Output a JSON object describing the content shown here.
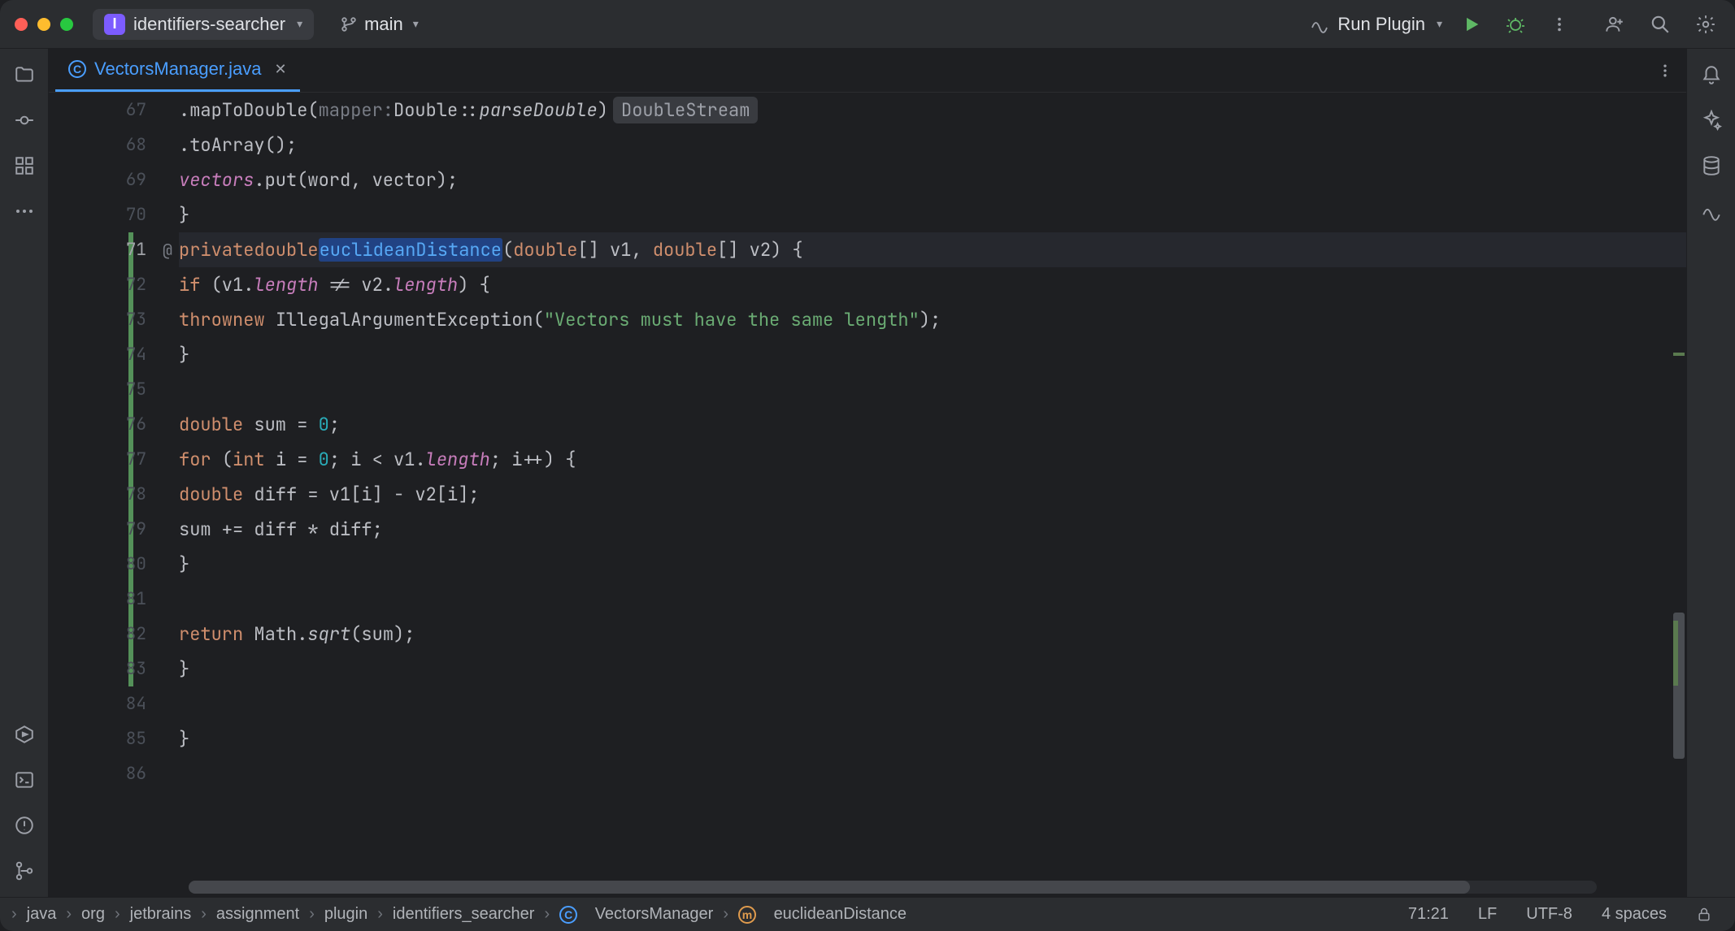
{
  "project": {
    "icon_letter": "I",
    "name": "identifiers-searcher"
  },
  "branch": "main",
  "run_config": "Run Plugin",
  "tab": {
    "filename": "VectorsManager.java"
  },
  "code": {
    "lines": [
      {
        "n": 67,
        "kind": "plain"
      },
      {
        "n": 68,
        "kind": "plain"
      },
      {
        "n": 69,
        "kind": "plain"
      },
      {
        "n": 70,
        "kind": "plain"
      },
      {
        "n": 71,
        "kind": "active"
      },
      {
        "n": 72,
        "kind": "plain"
      },
      {
        "n": 73,
        "kind": "plain"
      },
      {
        "n": 74,
        "kind": "plain"
      },
      {
        "n": 75,
        "kind": "plain"
      },
      {
        "n": 76,
        "kind": "plain"
      },
      {
        "n": 77,
        "kind": "plain"
      },
      {
        "n": 78,
        "kind": "plain"
      },
      {
        "n": 79,
        "kind": "plain"
      },
      {
        "n": 80,
        "kind": "plain"
      },
      {
        "n": 81,
        "kind": "plain"
      },
      {
        "n": 82,
        "kind": "plain"
      },
      {
        "n": 83,
        "kind": "plain"
      },
      {
        "n": 84,
        "kind": "plain"
      },
      {
        "n": 85,
        "kind": "plain"
      },
      {
        "n": 86,
        "kind": "plain"
      }
    ],
    "l67_method": ".mapToDouble(",
    "l67_hint_label": "mapper:",
    "l67_ref": "Double::",
    "l67_fn": "parseDouble",
    "l67_close": ")",
    "l67_inlay": "DoubleStream",
    "l68": ".toArray();",
    "l69_a": "vectors",
    "l69_b": ".put(word, vector);",
    "l70": "}",
    "l71_kw1": "private",
    "l71_kw2": "double",
    "l71_fn": "euclideanDistance",
    "l71_sig": "(",
    "l71_t1": "double",
    "l71_p1": "[] v1, ",
    "l71_t2": "double",
    "l71_p2": "[] v2) {",
    "l72_kw": "if",
    "l72_a": " (v1.",
    "l72_f1": "length",
    "l72_b": " != v2.",
    "l72_f2": "length",
    "l72_c": ") {",
    "l73_kw1": "throw",
    "l73_kw2": "new",
    "l73_ex": " IllegalArgumentException(",
    "l73_str": "\"Vectors must have the same length\"",
    "l73_end": ");",
    "l74": "}",
    "l76_kw": "double",
    "l76_rest": " sum = ",
    "l76_num": "0",
    "l76_end": ";",
    "l77_kw": "for",
    "l77_a": " (",
    "l77_t": "int",
    "l77_b": " i = ",
    "l77_n1": "0",
    "l77_c": "; i < v1.",
    "l77_f": "length",
    "l77_d": "; i++) {",
    "l78_kw": "double",
    "l78_rest": " diff = v1[i] - v2[i];",
    "l79": "sum += diff * diff;",
    "l80": "}",
    "l82_kw": "return",
    "l82_a": " Math.",
    "l82_fn": "sqrt",
    "l82_b": "(sum);",
    "l83": "}",
    "l85": "}"
  },
  "breadcrumbs": [
    "java",
    "org",
    "jetbrains",
    "assignment",
    "plugin",
    "identifiers_searcher",
    "VectorsManager",
    "euclideanDistance"
  ],
  "status": {
    "pos": "71:21",
    "lineend": "LF",
    "encoding": "UTF-8",
    "indent": "4 spaces"
  }
}
